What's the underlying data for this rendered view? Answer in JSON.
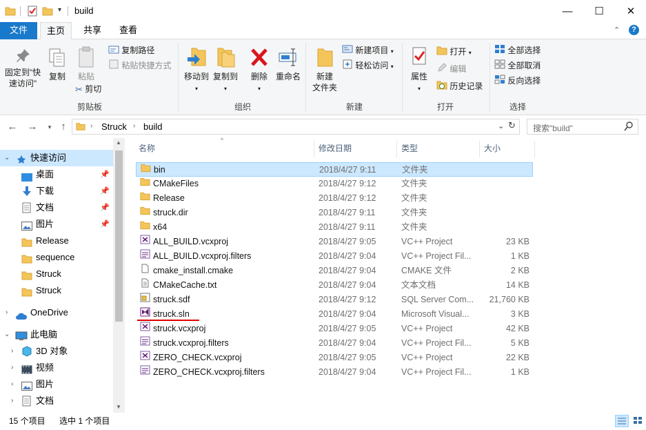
{
  "window": {
    "title": "build"
  },
  "titlebar_controls": {
    "minimize": "—",
    "maximize": "☐",
    "close": "✕"
  },
  "ribbon_tabs": [
    "文件",
    "主页",
    "共享",
    "查看"
  ],
  "ribbon": {
    "clipboard": {
      "label": "剪贴板",
      "pin": "固定到\"快\n速访问\"",
      "pin_line1": "固定到\"快",
      "pin_line2": "速访问\"",
      "copy": "复制",
      "paste": "粘贴",
      "copy_path": "复制路径",
      "paste_shortcut": "粘贴快捷方式",
      "cut": "剪切"
    },
    "organize": {
      "label": "组织",
      "move_to": "移动到",
      "copy_to": "复制到",
      "delete": "删除",
      "rename": "重命名"
    },
    "new": {
      "label": "新建",
      "new_folder_line1": "新建",
      "new_folder_line2": "文件夹",
      "new_item": "新建项目",
      "easy_access": "轻松访问"
    },
    "open": {
      "label": "打开",
      "properties": "属性",
      "open": "打开",
      "edit": "编辑",
      "history": "历史记录"
    },
    "select": {
      "label": "选择",
      "select_all": "全部选择",
      "select_none": "全部取消",
      "invert": "反向选择"
    }
  },
  "address": {
    "crumbs": [
      "Struck",
      "build"
    ],
    "search_placeholder": "搜索\"build\""
  },
  "nav": {
    "quick_access": "快速访问",
    "quick_items": [
      {
        "label": "桌面",
        "pinned": true
      },
      {
        "label": "下载",
        "pinned": true
      },
      {
        "label": "文档",
        "pinned": true
      },
      {
        "label": "图片",
        "pinned": true
      },
      {
        "label": "Release",
        "pinned": false
      },
      {
        "label": "sequence",
        "pinned": false
      },
      {
        "label": "Struck",
        "pinned": false
      },
      {
        "label": "Struck",
        "pinned": false
      }
    ],
    "onedrive": "OneDrive",
    "this_pc": "此电脑",
    "pc_items": [
      "3D 对象",
      "视频",
      "图片",
      "文档"
    ]
  },
  "columns": {
    "name": "名称",
    "date": "修改日期",
    "type": "类型",
    "size": "大小"
  },
  "files": [
    {
      "name": "bin",
      "date": "2018/4/27 9:11",
      "type": "文件夹",
      "size": "",
      "icon": "folder-icon",
      "selected": true
    },
    {
      "name": "CMakeFiles",
      "date": "2018/4/27 9:12",
      "type": "文件夹",
      "size": "",
      "icon": "folder-icon"
    },
    {
      "name": "Release",
      "date": "2018/4/27 9:12",
      "type": "文件夹",
      "size": "",
      "icon": "folder-icon"
    },
    {
      "name": "struck.dir",
      "date": "2018/4/27 9:11",
      "type": "文件夹",
      "size": "",
      "icon": "folder-icon"
    },
    {
      "name": "x64",
      "date": "2018/4/27 9:11",
      "type": "文件夹",
      "size": "",
      "icon": "folder-icon"
    },
    {
      "name": "ALL_BUILD.vcxproj",
      "date": "2018/4/27 9:05",
      "type": "VC++ Project",
      "size": "23 KB",
      "icon": "vcxproj-icon"
    },
    {
      "name": "ALL_BUILD.vcxproj.filters",
      "date": "2018/4/27 9:04",
      "type": "VC++ Project Fil...",
      "size": "1 KB",
      "icon": "filters-icon"
    },
    {
      "name": "cmake_install.cmake",
      "date": "2018/4/27 9:04",
      "type": "CMAKE 文件",
      "size": "2 KB",
      "icon": "file-icon"
    },
    {
      "name": "CMakeCache.txt",
      "date": "2018/4/27 9:04",
      "type": "文本文档",
      "size": "14 KB",
      "icon": "text-file-icon"
    },
    {
      "name": "struck.sdf",
      "date": "2018/4/27 9:12",
      "type": "SQL Server Com...",
      "size": "21,760 KB",
      "icon": "sdf-icon"
    },
    {
      "name": "struck.sln",
      "date": "2018/4/27 9:04",
      "type": "Microsoft Visual...",
      "size": "3 KB",
      "icon": "sln-icon",
      "underlined": true
    },
    {
      "name": "struck.vcxproj",
      "date": "2018/4/27 9:05",
      "type": "VC++ Project",
      "size": "42 KB",
      "icon": "vcxproj-icon"
    },
    {
      "name": "struck.vcxproj.filters",
      "date": "2018/4/27 9:04",
      "type": "VC++ Project Fil...",
      "size": "5 KB",
      "icon": "filters-icon"
    },
    {
      "name": "ZERO_CHECK.vcxproj",
      "date": "2018/4/27 9:05",
      "type": "VC++ Project",
      "size": "22 KB",
      "icon": "vcxproj-icon"
    },
    {
      "name": "ZERO_CHECK.vcxproj.filters",
      "date": "2018/4/27 9:04",
      "type": "VC++ Project Fil...",
      "size": "1 KB",
      "icon": "filters-icon"
    }
  ],
  "status": {
    "count": "15 个项目",
    "selected": "选中 1 个项目"
  },
  "colors": {
    "accent": "#1979ca",
    "selection": "#cce8ff",
    "underline": "#e00000"
  }
}
